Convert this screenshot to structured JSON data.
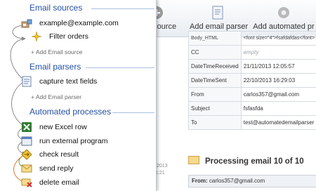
{
  "toolbar": {
    "btn1_label": "mail source",
    "btn2_label": "Add email parser",
    "btn3_label": "Add automated pr"
  },
  "details_table": {
    "rows": [
      {
        "key": "Body_HTML",
        "value": "<font size=\"4\">fsafdafdas</font>"
      },
      {
        "key": "CC",
        "value": "empty"
      },
      {
        "key": "DateTimeReceived",
        "value": "21/11/2013 12:05:57"
      },
      {
        "key": "DateTimeSent",
        "value": "22/10/2013 16:29:03"
      },
      {
        "key": "From",
        "value": "carlos357@gmail.com"
      },
      {
        "key": "Subject",
        "value": "fsfasfda"
      },
      {
        "key": "To",
        "value": "test@automatedemailparser"
      }
    ]
  },
  "processing": {
    "text": "Processing email 10 of 10"
  },
  "from_bar": {
    "label": "From:",
    "value": "carlos357@gmail.com"
  },
  "left_fragments": {
    "a": "/2013",
    "b": "1:21"
  },
  "panel": {
    "email_sources": {
      "title": "Email sources",
      "items": [
        "example@example.com",
        "Filter orders"
      ],
      "add_label": "+ Add Email source"
    },
    "email_parsers": {
      "title": "Email parsers",
      "items": [
        "capture text fields"
      ],
      "add_label": "+ Add Email parser"
    },
    "automated_processes": {
      "title": "Automated processes",
      "items": [
        "new Excel row",
        "run external program",
        "check result",
        "send reply",
        "delete email"
      ]
    }
  },
  "colors": {
    "section_title": "#2450a5",
    "section_line": "#a9c0e2",
    "flow_arrow": "#8a8a8a"
  }
}
